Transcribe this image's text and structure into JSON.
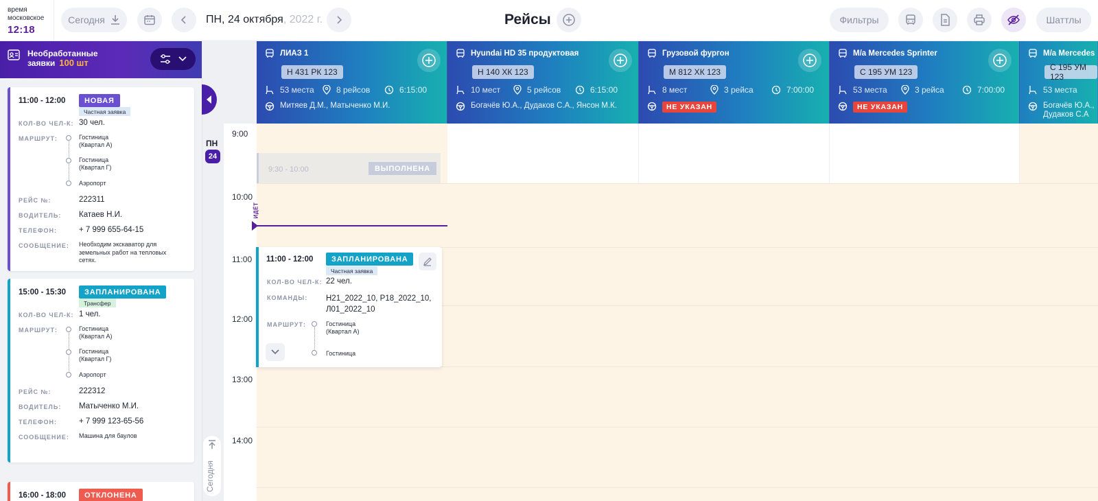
{
  "clock": {
    "label_line1": "время",
    "label_line2": "московское",
    "time": "12:18"
  },
  "toolbar": {
    "today_label": "Сегодня",
    "date_main": "ПН, 24 октября",
    "date_year": ", 2022 г.",
    "title": "Рейсы",
    "filters_label": "Фильтры",
    "shuttles_label": "Шаттлы"
  },
  "left_panel": {
    "title_line1": "Необработанные",
    "title_line2": "заявки",
    "count": "100 шт",
    "field_labels": {
      "people": "КОЛ-ВО ЧЕЛ-К:",
      "route": "МАРШРУТ:",
      "trip": "РЕЙС №:",
      "driver": "ВОДИТЕЛЬ:",
      "phone": "ТЕЛЕФОН:",
      "message": "СООБЩЕНИЕ:"
    },
    "cards": [
      {
        "time": "11:00 - 12:00",
        "status": "НОВАЯ",
        "type": "Частная заявка",
        "people": "30 чел.",
        "stops": [
          "Гостиница (Квартал А)",
          "Гостиница (Квартал Г)",
          "Аэропорт"
        ],
        "trip": "222311",
        "driver": "Катаев Н.И.",
        "phone": "+ 7 999 655-64-15",
        "message": "Необходим экскаватор для земельных работ на тепловых сетях."
      },
      {
        "time": "15:00 - 15:30",
        "status": "ЗАПЛАНИРОВАНА",
        "type": "Трансфер",
        "people": "1 чел.",
        "stops": [
          "Гостиница (Квартал А)",
          "Гостиница (Квартал Г)",
          "Аэропорт"
        ],
        "trip": "222312",
        "driver": "Матыченко М.И.",
        "phone": "+ 7 999 123-65-56",
        "message": "Машина для баулов"
      },
      {
        "time": "16:00 - 18:00",
        "status": "ОТКЛОНЕНА"
      }
    ]
  },
  "day": {
    "label": "ПН",
    "number": "24",
    "today_vertical": "Сегодня"
  },
  "time_slots": [
    "9:00",
    "10:00",
    "11:00",
    "12:00",
    "13:00",
    "14:00"
  ],
  "vehicles": [
    {
      "name": "ЛИАЗ 1",
      "plate": "Н 431 РК 123",
      "seats": "53 места",
      "trips": "8 рейсов",
      "duration": "6:15:00",
      "drivers": "Митяев Д.М., Матыченко М.И."
    },
    {
      "name": "Hyundai HD 35 продуктовая",
      "plate": "Н 140 ХК 123",
      "seats": "10 мест",
      "trips": "5 рейсов",
      "duration": "6:15:00",
      "drivers": "Богачёв Ю.А., Дудаков С.А., Янсон М.К."
    },
    {
      "name": "Грузовой фургон",
      "plate": "М 812 ХК 123",
      "seats": "8 мест",
      "trips": "3 рейса",
      "duration": "7:00:00",
      "drivers": "НЕ УКАЗАН"
    },
    {
      "name": "М/а Mercedes Sprinter",
      "plate": "С 195 УМ 123",
      "seats": "53 места",
      "trips": "3 рейса",
      "duration": "7:00:00",
      "drivers": "НЕ УКАЗАН"
    },
    {
      "name": "М/а Mercedes",
      "plate": "С 195 УМ 123",
      "seats": "53 места",
      "drivers_line1": "Богачёв Ю.А.,",
      "drivers_line2": "Дудаков С.А"
    }
  ],
  "events": {
    "done": {
      "time": "9:30 - 10:00",
      "status": "ВЫПОЛНЕНА"
    },
    "now_label": "ИДЁТ",
    "planned": {
      "time": "11:00 - 12:00",
      "status": "ЗАПЛАНИРОВАНА",
      "type": "Частная заявка",
      "people_label": "КОЛ-ВО ЧЕЛ-К:",
      "people": "22 чел.",
      "teams_label": "КОМАНДЫ:",
      "teams": "Н21_2022_10, Р18_2022_10, Л01_2022_10",
      "route_label": "МАРШРУТ:",
      "stops": [
        "Гостиница (Квартал А)",
        "Гостиница"
      ]
    }
  },
  "colors": {
    "brand_purple": "#4a1fa8",
    "status_new": "#6a4fd0",
    "status_planned": "#13a3c8",
    "status_rejected": "#ef5b4f",
    "status_done": "#c7ccdd",
    "not_set": "#e8453c"
  }
}
